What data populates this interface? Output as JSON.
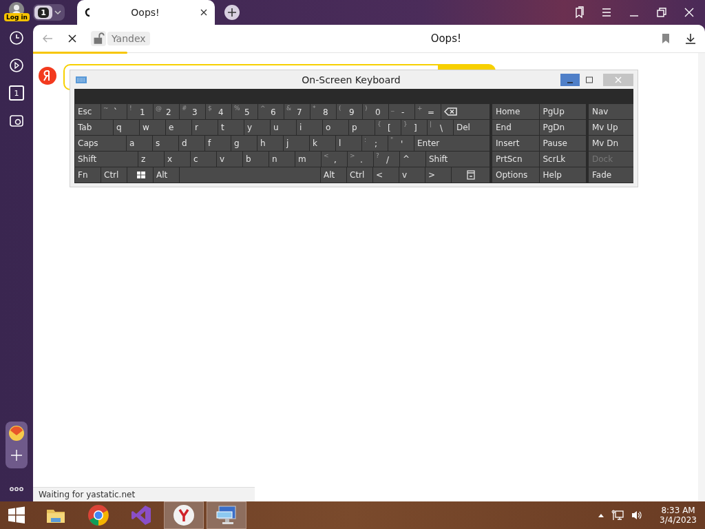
{
  "browser": {
    "login_label": "Log in",
    "tab_count": "1",
    "sidebar_count": "1",
    "tabs": [
      {
        "title": "Oops!",
        "selected": true
      }
    ],
    "address": {
      "site": "Yandex",
      "page_title": "Oops!"
    },
    "loading": {
      "level": 0.14
    },
    "status": "Waiting for yastatic.net"
  },
  "keyboard": {
    "title": "On-Screen Keyboard",
    "rows": [
      {
        "keys": [
          {
            "kind": "key",
            "label": "Esc"
          },
          {
            "kind": "char",
            "shift": "~",
            "label": "`"
          },
          {
            "kind": "char",
            "shift": "!",
            "label": "1"
          },
          {
            "kind": "char",
            "shift": "@",
            "label": "2"
          },
          {
            "kind": "char",
            "shift": "#",
            "label": "3"
          },
          {
            "kind": "char",
            "shift": "$",
            "label": "4"
          },
          {
            "kind": "char",
            "shift": "%",
            "label": "5"
          },
          {
            "kind": "char",
            "shift": "^",
            "label": "6"
          },
          {
            "kind": "char",
            "shift": "&",
            "label": "7"
          },
          {
            "kind": "char",
            "shift": "*",
            "label": "8"
          },
          {
            "kind": "char",
            "shift": "(",
            "label": "9"
          },
          {
            "kind": "char",
            "shift": ")",
            "label": "0"
          },
          {
            "kind": "char",
            "shift": "_",
            "label": "-"
          },
          {
            "kind": "char",
            "shift": "+",
            "label": "="
          },
          {
            "kind": "backspace"
          }
        ]
      },
      {
        "keys": [
          {
            "kind": "wide",
            "label": "Tab"
          },
          {
            "kind": "key",
            "label": "q"
          },
          {
            "kind": "key",
            "label": "w"
          },
          {
            "kind": "key",
            "label": "e"
          },
          {
            "kind": "key",
            "label": "r"
          },
          {
            "kind": "key",
            "label": "t"
          },
          {
            "kind": "key",
            "label": "y"
          },
          {
            "kind": "key",
            "label": "u"
          },
          {
            "kind": "key",
            "label": "i"
          },
          {
            "kind": "key",
            "label": "o"
          },
          {
            "kind": "key",
            "label": "p"
          },
          {
            "kind": "char",
            "shift": "{",
            "label": "["
          },
          {
            "kind": "char",
            "shift": "}",
            "label": "]"
          },
          {
            "kind": "char",
            "shift": "|",
            "label": "\\"
          },
          {
            "kind": "fill",
            "label": "Del"
          }
        ]
      },
      {
        "keys": [
          {
            "kind": "wider",
            "label": "Caps"
          },
          {
            "kind": "key",
            "label": "a"
          },
          {
            "kind": "key",
            "label": "s"
          },
          {
            "kind": "key",
            "label": "d"
          },
          {
            "kind": "key",
            "label": "f"
          },
          {
            "kind": "key",
            "label": "g"
          },
          {
            "kind": "key",
            "label": "h"
          },
          {
            "kind": "key",
            "label": "j"
          },
          {
            "kind": "key",
            "label": "k"
          },
          {
            "kind": "key",
            "label": "l"
          },
          {
            "kind": "char",
            "shift": ":",
            "label": ";"
          },
          {
            "kind": "char",
            "shift": "\"",
            "label": "'"
          },
          {
            "kind": "fill",
            "label": "Enter"
          }
        ]
      },
      {
        "keys": [
          {
            "kind": "widest",
            "label": "Shift"
          },
          {
            "kind": "key",
            "label": "z"
          },
          {
            "kind": "key",
            "label": "x"
          },
          {
            "kind": "key",
            "label": "c"
          },
          {
            "kind": "key",
            "label": "v"
          },
          {
            "kind": "key",
            "label": "b"
          },
          {
            "kind": "key",
            "label": "n"
          },
          {
            "kind": "key",
            "label": "m"
          },
          {
            "kind": "char",
            "shift": "<",
            "label": ","
          },
          {
            "kind": "char",
            "shift": ">",
            "label": "."
          },
          {
            "kind": "char",
            "shift": "?",
            "label": "/"
          },
          {
            "kind": "key",
            "label": "^"
          },
          {
            "kind": "fill",
            "label": "Shift"
          }
        ]
      },
      {
        "keys": [
          {
            "kind": "key",
            "label": "Fn"
          },
          {
            "kind": "key",
            "label": "Ctrl"
          },
          {
            "kind": "windows"
          },
          {
            "kind": "key",
            "label": "Alt"
          },
          {
            "kind": "space"
          },
          {
            "kind": "key",
            "label": "Alt"
          },
          {
            "kind": "key",
            "label": "Ctrl"
          },
          {
            "kind": "key",
            "label": "<"
          },
          {
            "kind": "key",
            "label": "v"
          },
          {
            "kind": "key",
            "label": ">"
          },
          {
            "kind": "menu"
          }
        ]
      }
    ],
    "nav_keys": [
      {
        "label": "Home"
      },
      {
        "label": "PgUp"
      },
      {
        "label": "End"
      },
      {
        "label": "PgDn"
      },
      {
        "label": "Insert"
      },
      {
        "label": "Pause"
      },
      {
        "label": "PrtScn"
      },
      {
        "label": "ScrLk"
      },
      {
        "label": "Options"
      },
      {
        "label": "Help"
      }
    ],
    "side_keys": [
      {
        "label": "Nav",
        "disabled": false
      },
      {
        "label": "Mv Up",
        "disabled": false
      },
      {
        "label": "Mv Dn",
        "disabled": false
      },
      {
        "label": "Dock",
        "disabled": true
      },
      {
        "label": "Fade",
        "disabled": false
      }
    ]
  },
  "taskbar": {
    "apps": [
      {
        "kind": "folder",
        "selected": false
      },
      {
        "kind": "chrome",
        "selected": false
      },
      {
        "kind": "studio",
        "selected": false
      },
      {
        "kind": "yandex",
        "selected": true
      },
      {
        "kind": "keyboard",
        "selected": true
      }
    ],
    "time": "8:33 AM",
    "date": "3/4/2023"
  }
}
